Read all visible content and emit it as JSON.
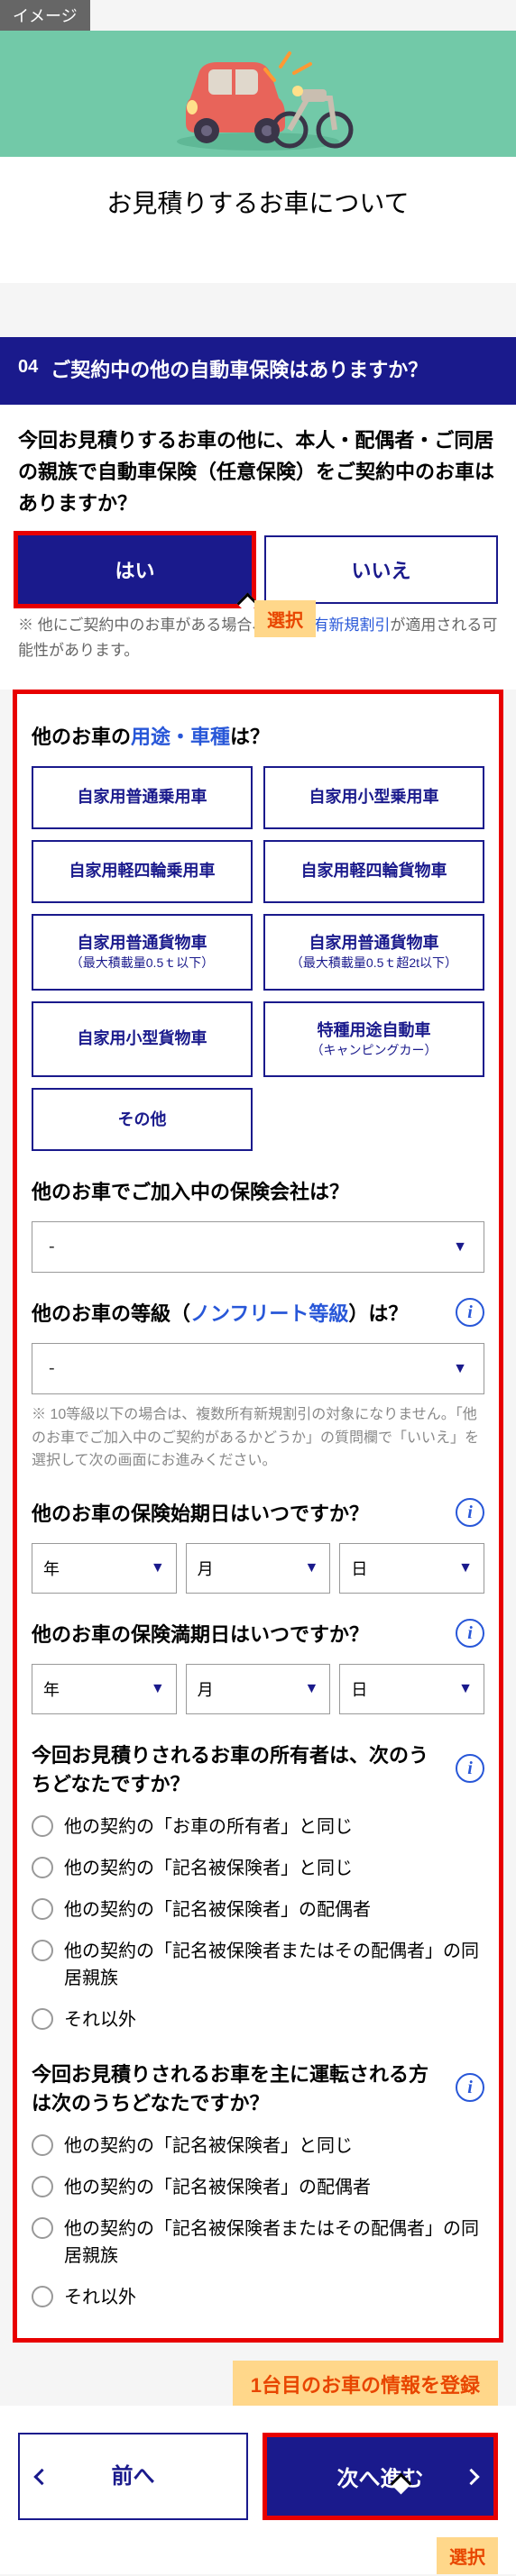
{
  "image_tag": "イメージ",
  "page_title": "お見積りするお車について",
  "q04": {
    "num": "04",
    "title": "ご契約中の他の自動車保険はありますか？",
    "text": "今回お見積りするお車の他に、本人・配偶者・ご同居の親族で自動車保険（任意保険）をご契約中のお車はありますか？",
    "yes": "はい",
    "no": "いいえ",
    "note_pre": "※ 他にご契約中のお車がある場合、",
    "note_link": "複数所有新規割引",
    "note_post": "が適用される可能性があります。",
    "select_badge": "選択"
  },
  "usage": {
    "q_pre": "他のお車の",
    "q_em": "用途・車種",
    "q_post": "は？",
    "options": [
      {
        "label": "自家用普通乗用車"
      },
      {
        "label": "自家用小型乗用車"
      },
      {
        "label": "自家用軽四輪乗用車"
      },
      {
        "label": "自家用軽四輪貨物車"
      },
      {
        "label": "自家用普通貨物車",
        "sub": "（最大積載量0.5ｔ以下）"
      },
      {
        "label": "自家用普通貨物車",
        "sub": "（最大積載量0.5ｔ超2t以下）"
      },
      {
        "label": "自家用小型貨物車"
      },
      {
        "label": "特種用途自動車",
        "sub": "（キャンピングカー）"
      },
      {
        "label": "その他"
      }
    ]
  },
  "company": {
    "q": "他のお車でご加入中の保険会社は？",
    "val": "-"
  },
  "grade": {
    "q_pre": "他のお車の等級（",
    "q_em": "ノンフリート等級",
    "q_post": "）は？",
    "val": "-",
    "note": "※ 10等級以下の場合は、複数所有新規割引の対象になりません。「他のお車でご加入中のご契約があるかどうか」の質問欄で「いいえ」を選択して次の画面にお進みください。"
  },
  "start_date": {
    "q": "他のお車の保険始期日はいつですか？"
  },
  "end_date": {
    "q": "他のお車の保険満期日はいつですか？"
  },
  "date_labels": {
    "year": "年",
    "month": "月",
    "day": "日"
  },
  "owner": {
    "q": "今回お見積りされるお車の所有者は、次のうちどなたですか？",
    "options": [
      "他の契約の「お車の所有者」と同じ",
      "他の契約の「記名被保険者」と同じ",
      "他の契約の「記名被保険者」の配偶者",
      "他の契約の「記名被保険者またはその配偶者」の同居親族",
      "それ以外"
    ]
  },
  "driver": {
    "q": "今回お見積りされるお車を主に運転される方は次のうちどなたですか？",
    "options": [
      "他の契約の「記名被保険者」と同じ",
      "他の契約の「記名被保険者」の配偶者",
      "他の契約の「記名被保険者またはその配偶者」の同居親族",
      "それ以外"
    ]
  },
  "callout": "1台目のお車の情報を登録",
  "nav": {
    "prev": "前へ",
    "next": "次へ進む",
    "select": "選択"
  }
}
